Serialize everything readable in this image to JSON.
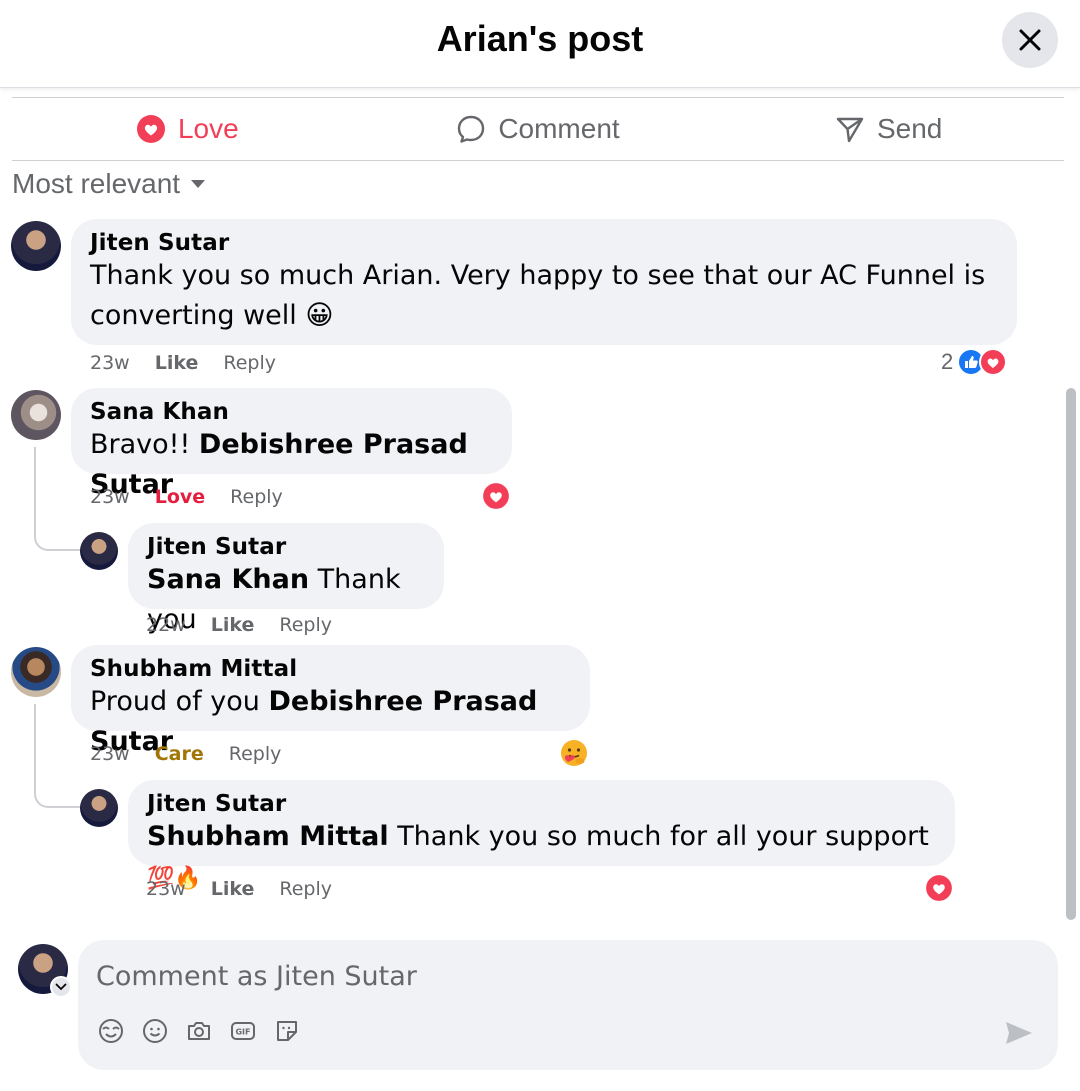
{
  "header": {
    "title": "Arian's post"
  },
  "actions": {
    "love": "Love",
    "comment": "Comment",
    "send": "Send"
  },
  "sort": {
    "label": "Most relevant"
  },
  "comments": [
    {
      "author": "Jiten Sutar",
      "text": "Thank you so much Arian. Very happy to see that our AC Funnel is converting well",
      "emoji": "😀",
      "time": "23w",
      "like": "Like",
      "reply": "Reply",
      "reaction_count": "2"
    },
    {
      "author": "Sana Khan",
      "text": "Bravo!! ",
      "mention": "Debishree Prasad Sutar",
      "time": "23w",
      "like": "Love",
      "reply": "Reply",
      "replies": [
        {
          "author": "Jiten Sutar",
          "mention": "Sana Khan",
          "text": " Thank you",
          "time": "22w",
          "like": "Like",
          "reply": "Reply"
        }
      ]
    },
    {
      "author": "Shubham Mittal",
      "text": "Proud of you ",
      "mention": "Debishree Prasad Sutar",
      "time": "23w",
      "like": "Care",
      "reply": "Reply",
      "replies": [
        {
          "author": "Jiten Sutar",
          "mention": "Shubham Mittal",
          "text": " Thank you so much for all your support ",
          "emoji": "💯🔥",
          "time": "23w",
          "like": "Like",
          "reply": "Reply"
        }
      ]
    }
  ],
  "composer": {
    "placeholder": "Comment as Jiten Sutar"
  },
  "colors": {
    "love": "#f33e58",
    "like_blue": "#1877f2",
    "care": "#a27606",
    "bubble": "#f0f2f5",
    "secondary_text": "#65676b"
  },
  "icons": [
    "close-icon",
    "heart-icon",
    "comment-icon",
    "send-icon",
    "caret-down-icon",
    "like-reaction-icon",
    "love-reaction-icon",
    "care-reaction-icon",
    "avatar-icon",
    "sticker-icon",
    "emoji-icon",
    "camera-icon",
    "gif-icon",
    "sticker-face-icon",
    "submit-arrow-icon"
  ]
}
